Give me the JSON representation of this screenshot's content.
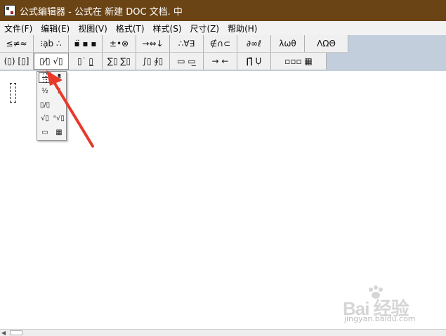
{
  "window": {
    "title": "公式编辑器 - 公式在 新建 DOC 文档. 中"
  },
  "menu": [
    {
      "label": "文件(F)"
    },
    {
      "label": "编辑(E)"
    },
    {
      "label": "视图(V)"
    },
    {
      "label": "格式(T)"
    },
    {
      "label": "样式(S)"
    },
    {
      "label": "尺寸(Z)"
    },
    {
      "label": "帮助(H)"
    }
  ],
  "toolbar": {
    "row1": [
      {
        "label": "≤≠≈",
        "name": "relations-palette"
      },
      {
        "label": "⁝ạb ∴",
        "name": "spaces-ellipses-palette"
      },
      {
        "label": "▪̈ ▪ ▪",
        "name": "embellishments-palette"
      },
      {
        "label": "±•⊗",
        "name": "operators-palette"
      },
      {
        "label": "→⇔↓",
        "name": "arrows-palette"
      },
      {
        "label": "∴∀∃",
        "name": "logic-palette"
      },
      {
        "label": "∉∩⊂",
        "name": "set-theory-palette"
      },
      {
        "label": "∂∞ℓ",
        "name": "misc-symbols-palette"
      },
      {
        "label": "λωθ",
        "name": "greek-lowercase-palette"
      },
      {
        "label": "ΛΩΘ",
        "name": "greek-uppercase-palette"
      }
    ],
    "row2": [
      {
        "label": "(▯) [▯]",
        "name": "fence-templates"
      },
      {
        "label": "▯⁄▯ √▯",
        "name": "fraction-radical-templates"
      },
      {
        "label": "▯˙ ▯̲",
        "name": "script-templates"
      },
      {
        "label": "∑▯ ∑▯",
        "name": "summation-templates"
      },
      {
        "label": "∫▯ ∮▯",
        "name": "integral-templates"
      },
      {
        "label": "▭ ▭̲",
        "name": "underbar-overbar-templates"
      },
      {
        "label": "→ ←",
        "name": "labeled-arrow-templates"
      },
      {
        "label": "∏̄ Ụ",
        "name": "product-set-templates"
      },
      {
        "label": "▫▫▫ ▦",
        "name": "matrix-templates"
      }
    ]
  },
  "popup": {
    "items": [
      {
        "name": "full-fraction-template",
        "kind": "frac"
      },
      {
        "name": "small-fraction-template",
        "kind": "smallfrac"
      },
      {
        "name": "slash-fraction-template",
        "label": "½"
      },
      {
        "name": "small-slash-fraction-template",
        "label": "/"
      },
      {
        "name": "inline-slash-fraction-template",
        "label": "▯/▯"
      },
      {
        "name": "square-root-template",
        "label": "√▯"
      },
      {
        "name": "nth-root-template",
        "label": "ⁿ√▯"
      },
      {
        "name": "long-division-template",
        "label": "▭"
      },
      {
        "name": "long-division-alt-template",
        "label": "▦"
      }
    ]
  },
  "watermark": {
    "brand": "Bai 经验",
    "url": "jingyan.baidu.com"
  },
  "colors": {
    "titlebar": "#6b4416",
    "arrow": "#e8392b",
    "toolbar_bg": "#c2cedb"
  }
}
